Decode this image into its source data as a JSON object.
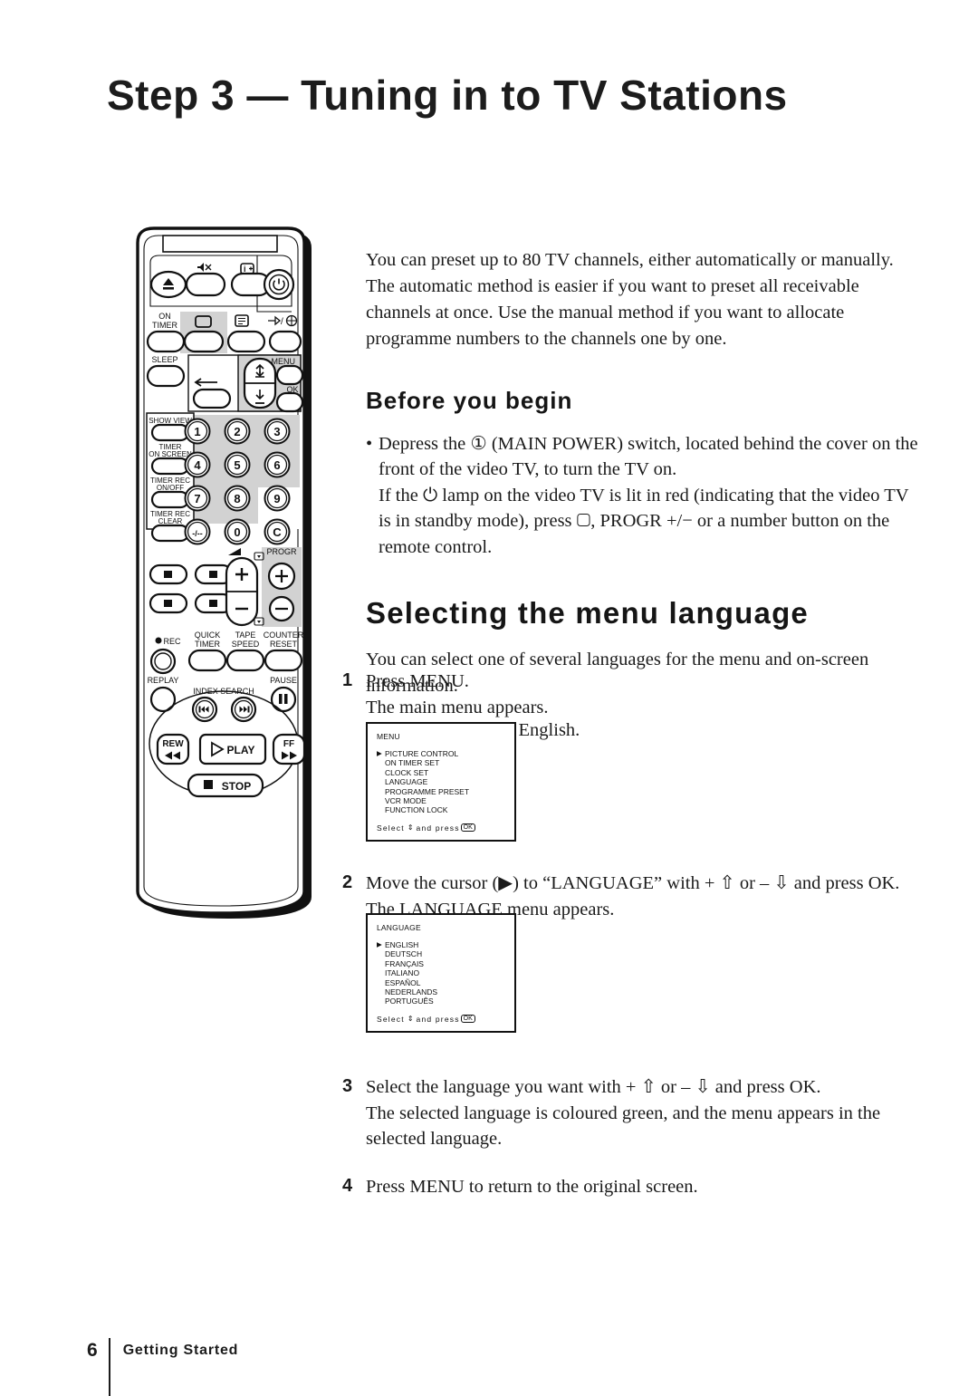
{
  "page": {
    "title": "Step 3 — Tuning in to TV Stations",
    "footer_page_number": "6",
    "footer_section": "Getting Started"
  },
  "intro": {
    "paragraph": "You can preset up to 80 TV channels, either automatically or manually. The automatic method is easier if you want to preset all receivable channels at once.  Use the manual method if you want to allocate programme numbers to the channels one by one."
  },
  "before_you_begin": {
    "heading": "Before you begin",
    "bullet_marker": "•",
    "bullet_line1": "Depress the ① (MAIN POWER) switch, located behind the cover on the front of the video TV, to turn the TV on.",
    "bullet_line2": "If the ⏻ lamp on the video TV is lit in red (indicating that the video TV is in standby mode), press ▢, PROGR +/− or a number button on the remote control."
  },
  "menu_language": {
    "heading": "Selecting the menu language",
    "paragraph1": "You can select one of several languages for the menu and on-screen information.",
    "paragraph2": "The initial setting is English."
  },
  "steps": [
    {
      "number": "1",
      "line1": "Press MENU.",
      "line2": "The main menu appears."
    },
    {
      "number": "2",
      "line1": "Move the cursor (▶) to “LANGUAGE” with + ⇧ or – ⇩ and press OK.",
      "line2": "The LANGUAGE menu appears."
    },
    {
      "number": "3",
      "line1": "Select the language you want with + ⇧ or – ⇩ and press OK.",
      "line2": "The selected language is coloured green, and the menu appears in the selected language."
    },
    {
      "number": "4",
      "line1": "Press MENU to return to the original screen.",
      "line2": ""
    }
  ],
  "osd_menu": {
    "title": "MENU",
    "items": [
      "PICTURE CONTROL",
      "ON TIMER SET",
      "CLOCK SET",
      "LANGUAGE",
      "PROGRAMME PRESET",
      "VCR MODE",
      "FUNCTION LOCK"
    ],
    "selected_index": 0,
    "footer_prefix": "Select",
    "footer_arrow": "⇕",
    "footer_middle": "and press",
    "footer_ok": "OK"
  },
  "osd_language": {
    "title": "LANGUAGE",
    "items": [
      "ENGLISH",
      "DEUTSCH",
      "FRANÇAIS",
      "ITALIANO",
      "ESPAÑOL",
      "NEDERLANDS",
      "PORTUGUÊS"
    ],
    "selected_index": 0,
    "footer_prefix": "Select",
    "footer_arrow": "⇕",
    "footer_middle": "and press",
    "footer_ok": "OK"
  },
  "remote": {
    "labels": {
      "on_timer_1": "ON",
      "on_timer_2": "TIMER",
      "sleep": "SLEEP",
      "show_view": "SHOW VIEW",
      "timer_onscreen_1": "TIMER",
      "timer_onscreen_2": "ON SCREEN",
      "timer_rec_onoff_1": "TIMER REC",
      "timer_rec_onoff_2": "ON/OFF",
      "timer_rec_clear_1": "TIMER REC",
      "timer_rec_clear_2": "CLEAR",
      "menu": "MENU",
      "ok": "OK",
      "progr": "PROGR",
      "rec": "REC",
      "quick_1": "QUICK",
      "quick_2": "TIMER",
      "tape_1": "TAPE",
      "tape_2": "SPEED",
      "counter_1": "COUNTER",
      "counter_2": "RESET",
      "replay": "REPLAY",
      "pause": "PAUSE",
      "index_search": "INDEX SEARCH",
      "rew": "REW",
      "ff": "FF",
      "play": "PLAY",
      "stop": "STOP",
      "input_select": "/",
      "keys": [
        "1",
        "2",
        "3",
        "4",
        "5",
        "6",
        "7",
        "8",
        "9",
        "-/--",
        "0",
        "C"
      ]
    }
  }
}
